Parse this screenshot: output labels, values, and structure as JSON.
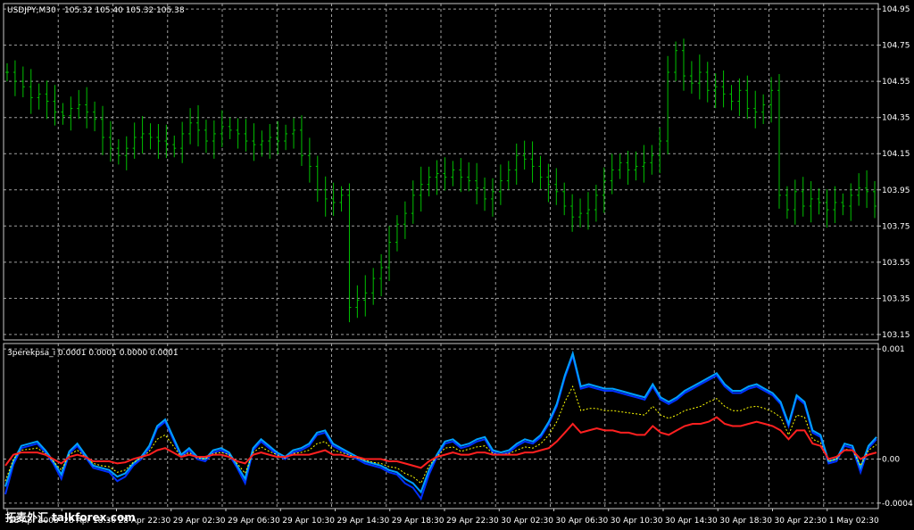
{
  "colors": {
    "background": "#000000",
    "grid": "#a0a0a0",
    "frame": "#c8c8c8",
    "text": "#ffffff",
    "bars": "#00c000",
    "ind_fast": "#00a0ff",
    "ind_slow": "#0030ff",
    "ind_signal": "#ffff00",
    "ind_red": "#ff2020"
  },
  "chart_data": [
    {
      "type": "ohlc",
      "title": "USDJPY,M30",
      "ohlc_header": "105.32 105.40 105.32 105.38",
      "ylim": [
        103.12,
        104.98
      ],
      "y_ticks": [
        "104.95",
        "104.75",
        "104.55",
        "104.35",
        "104.15",
        "103.95",
        "103.75",
        "103.55",
        "103.35",
        "103.15"
      ],
      "grid": true,
      "close": [
        104.6,
        104.55,
        104.52,
        104.46,
        104.48,
        104.44,
        104.38,
        104.36,
        104.4,
        104.42,
        104.38,
        104.34,
        104.24,
        104.18,
        104.14,
        104.18,
        104.24,
        104.26,
        104.24,
        104.22,
        104.2,
        104.18,
        104.26,
        104.32,
        104.28,
        104.22,
        104.26,
        104.3,
        104.28,
        104.26,
        104.22,
        104.2,
        104.22,
        104.24,
        104.22,
        104.26,
        104.28,
        104.14,
        104.08,
        103.95,
        103.9,
        103.88,
        103.92,
        103.3,
        103.34,
        103.38,
        103.46,
        103.52,
        103.66,
        103.76,
        103.82,
        103.92,
        103.98,
        104.02,
        104.04,
        104.02,
        104.06,
        104.02,
        104.0,
        103.96,
        103.9,
        103.94,
        104.0,
        104.06,
        104.14,
        104.12,
        104.08,
        104.02,
        103.98,
        103.94,
        103.86,
        103.8,
        103.82,
        103.84,
        103.92,
        104.0,
        104.06,
        104.1,
        104.06,
        104.08,
        104.1,
        104.14,
        104.22,
        104.6,
        104.72,
        104.58,
        104.54,
        104.6,
        104.5,
        104.52,
        104.48,
        104.44,
        104.5,
        104.4,
        104.38,
        104.42,
        104.5,
        103.92,
        103.84,
        103.94,
        103.86,
        103.9,
        103.88,
        103.84,
        103.88,
        103.86,
        103.92,
        103.96,
        103.94,
        103.86
      ]
    },
    {
      "type": "line",
      "title": "3perekpsa_i 0.0001 0.0001 0.0000 0.0001",
      "ylim": [
        -0.00045,
        0.00105
      ],
      "y_ticks": [
        "0.001",
        "0.00",
        "-0.0004"
      ],
      "grid": true,
      "x_ticks": [
        "28 Apr 2008",
        "28 Apr 18:30",
        "28 Apr 22:30",
        "29 Apr 02:30",
        "29 Apr 06:30",
        "29 Apr 10:30",
        "29 Apr 14:30",
        "29 Apr 18:30",
        "29 Apr 22:30",
        "30 Apr 02:30",
        "30 Apr 06:30",
        "30 Apr 10:30",
        "30 Apr 14:30",
        "30 Apr 18:30",
        "30 Apr 22:30",
        "1 May 02:30"
      ],
      "series": [
        {
          "values": [
            -0.00032,
            -5e-05,
            0.0001,
            0.00012,
            0.00014,
            6e-05,
            -4e-05,
            -0.00018,
            5e-05,
            0.00012,
            2e-05,
            -8e-05,
            -0.0001,
            -0.00012,
            -0.0002,
            -0.00016,
            -6e-05,
            0.0,
            0.0001,
            0.00028,
            0.00034,
            0.00018,
            2e-05,
            8e-05,
            0.0,
            -2e-05,
            6e-05,
            8e-05,
            4e-05,
            -8e-05,
            -0.00022,
            8e-05,
            0.00016,
            0.0001,
            4e-05,
            0.0,
            6e-05,
            8e-05,
            0.00012,
            0.00022,
            0.00024,
            0.00012,
            8e-05,
            4e-05,
            0.0,
            -4e-05,
            -6e-05,
            -8e-05,
            -0.00012,
            -0.00014,
            -0.00022,
            -0.00026,
            -0.00036,
            -0.00014,
            2e-05,
            0.00014,
            0.00016,
            0.0001,
            0.00012,
            0.00016,
            0.00018,
            6e-05,
            4e-05,
            6e-05,
            0.00012,
            0.00016,
            0.00014,
            0.0002,
            0.00032,
            0.00048,
            0.00074,
            0.00094,
            0.00064,
            0.00066,
            0.00064,
            0.00062,
            0.00062,
            0.0006,
            0.00058,
            0.00056,
            0.00054,
            0.00066,
            0.00054,
            0.0005,
            0.00054,
            0.0006,
            0.00064,
            0.00068,
            0.00072,
            0.00076,
            0.00066,
            0.0006,
            0.0006,
            0.00064,
            0.00066,
            0.00062,
            0.00058,
            0.0005,
            0.0003,
            0.00056,
            0.0005,
            0.00024,
            0.0002,
            -4e-05,
            -2e-05,
            0.00012,
            0.0001,
            -0.00012,
            0.0001,
            0.00018
          ],
          "color": "ind_slow"
        },
        {
          "values": [
            -0.00025,
            -2e-05,
            0.00012,
            0.00014,
            0.00016,
            8e-05,
            -2e-05,
            -0.00014,
            7e-05,
            0.00014,
            4e-05,
            -6e-05,
            -8e-05,
            -0.0001,
            -0.00016,
            -0.00013,
            -4e-05,
            2e-05,
            0.00012,
            0.0003,
            0.00036,
            0.0002,
            4e-05,
            0.0001,
            2e-05,
            0.0,
            8e-05,
            0.0001,
            6e-05,
            -6e-05,
            -0.00018,
            0.0001,
            0.00018,
            0.00012,
            6e-05,
            2e-05,
            8e-05,
            0.0001,
            0.00014,
            0.00024,
            0.00026,
            0.00014,
            0.0001,
            6e-05,
            2e-05,
            -2e-05,
            -4e-05,
            -6e-05,
            -0.0001,
            -0.00012,
            -0.00018,
            -0.00022,
            -0.0003,
            -0.0001,
            4e-05,
            0.00016,
            0.00018,
            0.00012,
            0.00014,
            0.00018,
            0.0002,
            8e-05,
            6e-05,
            8e-05,
            0.00014,
            0.00018,
            0.00016,
            0.00022,
            0.00034,
            0.0005,
            0.00076,
            0.00096,
            0.00066,
            0.00068,
            0.00066,
            0.00064,
            0.00064,
            0.00062,
            0.0006,
            0.00058,
            0.00056,
            0.00068,
            0.00056,
            0.00052,
            0.00056,
            0.00062,
            0.00066,
            0.0007,
            0.00074,
            0.00078,
            0.00068,
            0.00062,
            0.00062,
            0.00066,
            0.00068,
            0.00064,
            0.0006,
            0.00052,
            0.00032,
            0.00058,
            0.00052,
            0.00026,
            0.00022,
            -2e-05,
            0.0,
            0.00014,
            0.00012,
            -8e-05,
            0.00012,
            0.0002
          ],
          "color": "ind_fast"
        },
        {
          "values": [
            -0.0002,
            0.0,
            8e-05,
            9e-05,
            0.0001,
            5e-05,
            -2e-05,
            -0.0001,
            4e-05,
            8e-05,
            2e-05,
            -4e-05,
            -6e-05,
            -7e-05,
            -0.00012,
            -0.0001,
            -3e-05,
            1e-05,
            7e-05,
            0.00018,
            0.00022,
            0.00012,
            2e-05,
            6e-05,
            1e-05,
            0.0,
            5e-05,
            6e-05,
            4e-05,
            -4e-05,
            -0.00013,
            6e-05,
            0.00011,
            7e-05,
            4e-05,
            1e-05,
            5e-05,
            6e-05,
            8e-05,
            0.00014,
            0.00016,
            8e-05,
            6e-05,
            4e-05,
            1e-05,
            -1e-05,
            -3e-05,
            -4e-05,
            -7e-05,
            -8e-05,
            -0.00013,
            -0.00016,
            -0.00022,
            -6e-05,
            2e-05,
            0.0001,
            0.00011,
            7e-05,
            9e-05,
            0.00011,
            0.00012,
            5e-05,
            4e-05,
            5e-05,
            8e-05,
            0.00011,
            0.0001,
            0.00014,
            0.00022,
            0.00034,
            0.00052,
            0.00066,
            0.00044,
            0.00046,
            0.00046,
            0.00044,
            0.00044,
            0.00043,
            0.00042,
            0.00041,
            0.0004,
            0.00048,
            0.0004,
            0.00037,
            0.0004,
            0.00044,
            0.00046,
            0.00048,
            0.00052,
            0.00055,
            0.00048,
            0.00044,
            0.00044,
            0.00047,
            0.00048,
            0.00046,
            0.00043,
            0.00038,
            0.00022,
            0.0004,
            0.00038,
            0.00018,
            0.00015,
            -2e-05,
            0.0,
            9e-05,
            8e-05,
            -6e-05,
            8e-05,
            0.00013
          ],
          "color": "ind_signal",
          "dashed": true
        },
        {
          "values": [
            -6e-05,
            4e-05,
            6e-05,
            6e-05,
            6e-05,
            4e-05,
            0.0,
            -4e-05,
            2e-05,
            4e-05,
            2e-05,
            -2e-05,
            -2e-05,
            -2e-05,
            -4e-05,
            -3e-05,
            0.0,
            2e-05,
            4e-05,
            8e-05,
            0.0001,
            6e-05,
            2e-05,
            4e-05,
            2e-05,
            2e-05,
            4e-05,
            4e-05,
            2e-05,
            -2e-05,
            -4e-05,
            4e-05,
            6e-05,
            4e-05,
            2e-05,
            2e-05,
            4e-05,
            4e-05,
            4e-05,
            6e-05,
            8e-05,
            4e-05,
            4e-05,
            2e-05,
            2e-05,
            0.0,
            0.0,
            0.0,
            -2e-05,
            -2e-05,
            -4e-05,
            -6e-05,
            -8e-05,
            -2e-05,
            2e-05,
            4e-05,
            6e-05,
            4e-05,
            4e-05,
            6e-05,
            6e-05,
            4e-05,
            4e-05,
            4e-05,
            4e-05,
            6e-05,
            6e-05,
            8e-05,
            0.0001,
            0.00016,
            0.00024,
            0.00032,
            0.00024,
            0.00026,
            0.00028,
            0.00026,
            0.00026,
            0.00024,
            0.00024,
            0.00022,
            0.00022,
            0.0003,
            0.00024,
            0.00022,
            0.00026,
            0.0003,
            0.00032,
            0.00032,
            0.00034,
            0.00038,
            0.00032,
            0.0003,
            0.0003,
            0.00032,
            0.00034,
            0.00032,
            0.0003,
            0.00026,
            0.00018,
            0.00026,
            0.00026,
            0.00014,
            0.00012,
            0.0,
            2e-05,
            8e-05,
            8e-05,
            0.0,
            4e-05,
            6e-05
          ],
          "color": "ind_red"
        }
      ]
    }
  ],
  "watermark": "拓麦外汇 talkforex.com"
}
